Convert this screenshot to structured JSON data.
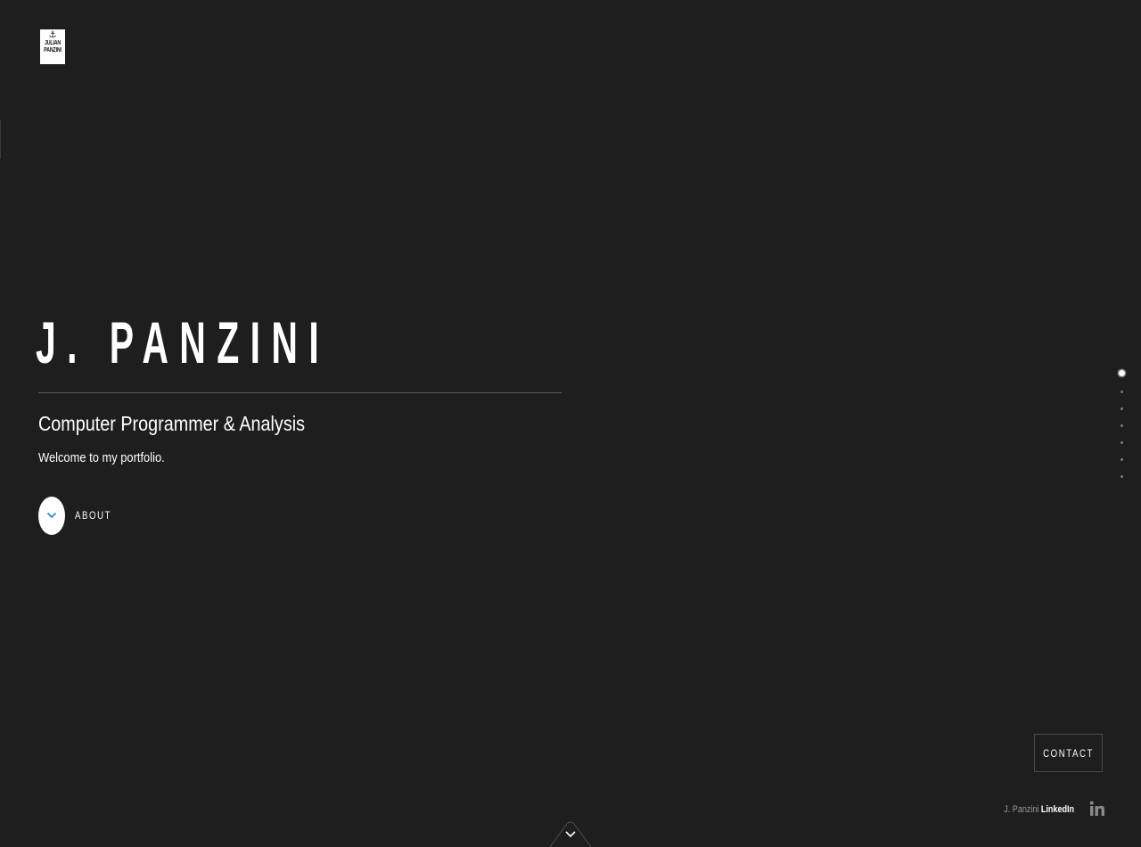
{
  "logo": {
    "icon": "anchor-icon",
    "line1": "JULIAN",
    "line2": "PANZINI"
  },
  "hero": {
    "title": "J. PANZINI",
    "subtitle": "Computer Programmer & Analysis",
    "welcome": "Welcome to my portfolio."
  },
  "about": {
    "label": "ABOUT",
    "icon": "chevron-down-icon"
  },
  "section_nav": {
    "count": 7,
    "active_index": 0
  },
  "contact": {
    "label": "CONTACT"
  },
  "footer": {
    "name": "J. Panzini",
    "link_label": "LinkedIn",
    "icon": "linkedin-icon"
  },
  "colors": {
    "background": "#1e1e1e",
    "text": "#ffffff",
    "accent": "#2e8bd8",
    "muted": "#9a9a9a"
  }
}
